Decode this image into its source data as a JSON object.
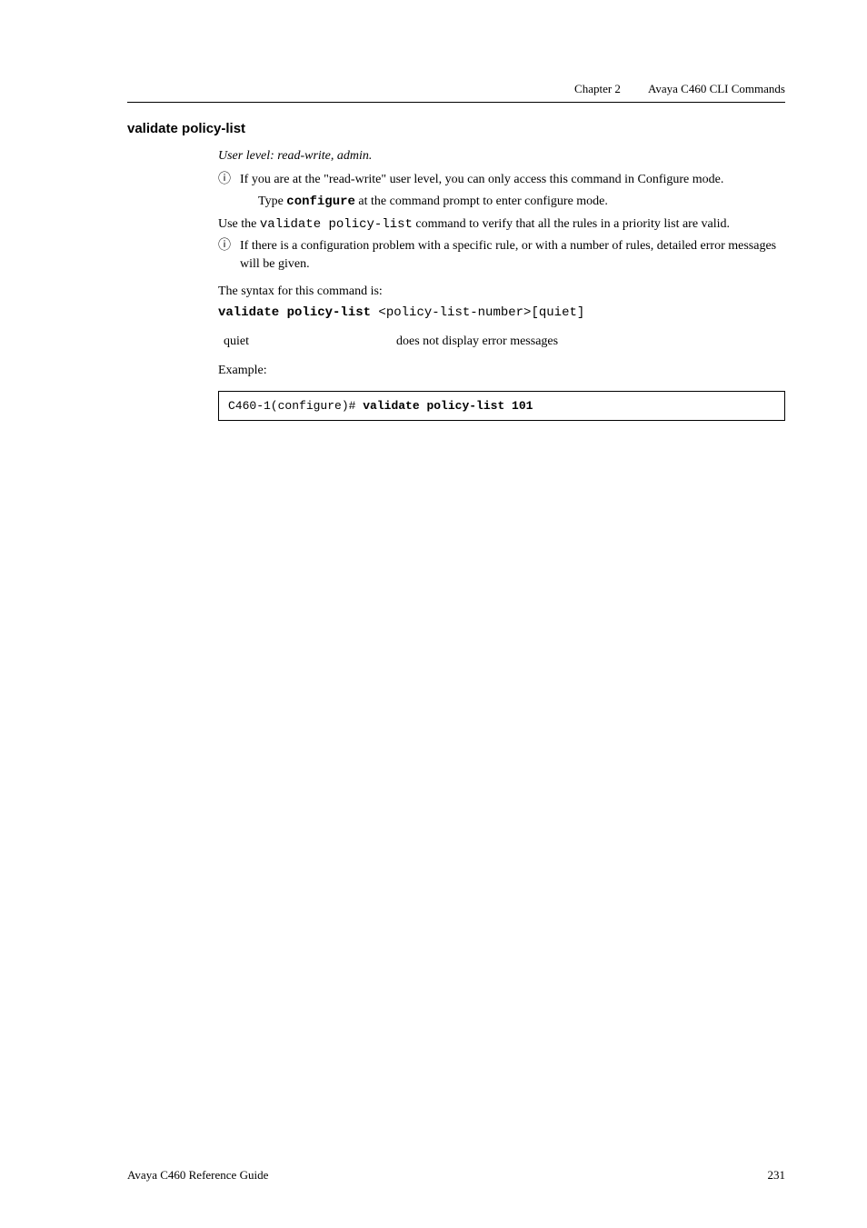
{
  "header": {
    "chapter_label": "Chapter 2",
    "chapter_name": "Avaya C460 CLI Commands"
  },
  "section": {
    "title": "validate policy-list"
  },
  "user_level": "User level: read-write, admin.",
  "info1_part1": "If you are at the \"read-write\" user level, you can only access this command in Configure mode.",
  "info1_sub_prefix": "Type ",
  "info1_sub_cmd": "configure",
  "info1_sub_suffix": " at the command prompt to enter configure mode.",
  "usage_prefix": "Use the ",
  "usage_cmd": "validate policy-list",
  "usage_suffix": " command to verify that all the rules in a priority list are valid.",
  "info2": "If there is a configuration problem with a specific rule, or with a number of rules, detailed error messages will be given.",
  "syntax_label": "The syntax for this command is:",
  "syntax_bold": "validate policy-list",
  "syntax_rest": " <policy-list-number>[quiet]",
  "param": {
    "name": "quiet",
    "desc": "does not display error messages"
  },
  "example_label": "Example:",
  "code_prefix": "C460-1(configure)# ",
  "code_bold": "validate policy-list 101",
  "footer": {
    "guide": "Avaya C460 Reference Guide",
    "page": "231"
  }
}
